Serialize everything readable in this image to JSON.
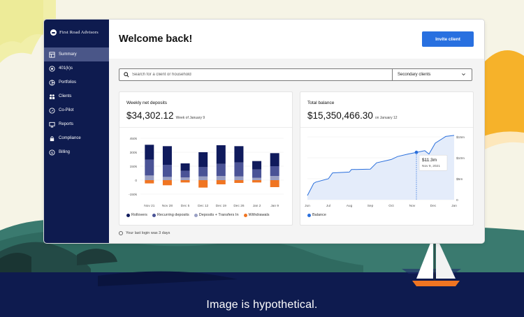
{
  "app": {
    "brand": "First Road Advisors",
    "page_title": "Welcome back!",
    "invite_button": "Invite client"
  },
  "sidebar": {
    "items": [
      {
        "label": "Summary",
        "icon": "summary-icon",
        "active": true
      },
      {
        "label": "401(k)s",
        "icon": "401k-icon",
        "active": false
      },
      {
        "label": "Portfolios",
        "icon": "portfolios-icon",
        "active": false
      },
      {
        "label": "Clients",
        "icon": "clients-icon",
        "active": false
      },
      {
        "label": "Co-Pilot",
        "icon": "copilot-icon",
        "active": false
      },
      {
        "label": "Reports",
        "icon": "reports-icon",
        "active": false
      },
      {
        "label": "Compliance",
        "icon": "compliance-icon",
        "active": false
      },
      {
        "label": "Billing",
        "icon": "billing-icon",
        "active": false
      }
    ]
  },
  "search": {
    "placeholder": "Search for a client or household",
    "filter_selected": "Secondary clients"
  },
  "deposits_card": {
    "title": "Weekly net deposits",
    "value": "$34,302.12",
    "subtitle": "Week of January 9"
  },
  "balance_card": {
    "title": "Total balance",
    "value": "$15,350,466.30",
    "subtitle": "on January 12"
  },
  "footer": {
    "last_login": "Your last login was 3 days"
  },
  "caption": "Image is hypothetical.",
  "colors": {
    "navy": "#0e1b4f",
    "accent": "#2870e0",
    "rollovers": "#0f1a5c",
    "recurring": "#4a5396",
    "transfers": "#9aa0c4",
    "withdrawals": "#f07522",
    "balance_line": "#2a6fdc",
    "balance_fill": "#e4ecfa"
  },
  "chart_data": [
    {
      "type": "bar",
      "stacked": true,
      "title": "Weekly net deposits",
      "categories": [
        "Nov 21",
        "Nov 28",
        "Dec 5",
        "Dec 12",
        "Dec 19",
        "Dec 26",
        "Jan 2",
        "Jan 9"
      ],
      "y_ticks": [
        "450k",
        "300k",
        "150k",
        "0",
        "-150k"
      ],
      "ylim": [
        -150000,
        450000
      ],
      "series": [
        {
          "name": "Withdrawals",
          "color": "#f07522",
          "values": [
            -35000,
            -55000,
            -25000,
            -80000,
            -45000,
            -30000,
            -25000,
            -75000
          ]
        },
        {
          "name": "Deposits + Transfers In",
          "color": "#9aa0c4",
          "values": [
            50000,
            35000,
            30000,
            40000,
            45000,
            40000,
            25000,
            45000
          ]
        },
        {
          "name": "Recurring deposits",
          "color": "#4a5396",
          "values": [
            170000,
            130000,
            70000,
            100000,
            130000,
            150000,
            90000,
            105000
          ]
        },
        {
          "name": "Rollovers",
          "color": "#0f1a5c",
          "values": [
            160000,
            200000,
            80000,
            160000,
            200000,
            175000,
            90000,
            140000
          ]
        }
      ],
      "legend": [
        "Rollovers",
        "Recurring deposits",
        "Deposits + Transfers In",
        "Withdrawals"
      ],
      "legend_position": "bottom-left"
    },
    {
      "type": "area",
      "title": "Total balance",
      "categories": [
        "Jun",
        "Jul",
        "Aug",
        "Sep",
        "Oct",
        "Nov",
        "Dec",
        "Jan"
      ],
      "y_ticks": [
        "$15m",
        "$10m",
        "$5m",
        "0"
      ],
      "ylim": [
        0,
        15000000
      ],
      "series": [
        {
          "name": "Balance",
          "color": "#2a6fdc",
          "x": [
            0,
            0.3,
            0.4,
            1.0,
            1.2,
            2.0,
            2.1,
            3.0,
            3.3,
            4.0,
            4.3,
            4.8,
            5.2,
            5.6,
            5.8,
            6.1,
            6.6,
            7.0
          ],
          "values": [
            1000000,
            3900000,
            4200000,
            5000000,
            6400000,
            6600000,
            7200000,
            7300000,
            8800000,
            9600000,
            10300000,
            10900000,
            11300000,
            11700000,
            10900000,
            13500000,
            15100000,
            15350000
          ]
        }
      ],
      "annotation": {
        "label": "$11.3m",
        "date": "Nov 9, 2021"
      },
      "legend": [
        "Balance"
      ],
      "legend_position": "bottom-left"
    }
  ]
}
